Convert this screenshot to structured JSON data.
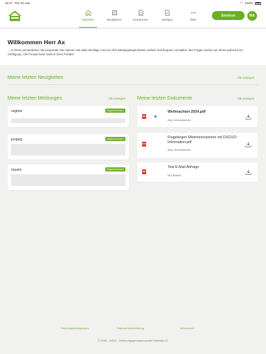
{
  "status_bar": {
    "time": "16:27",
    "date": "Thu 30 Jan",
    "battery": "100%"
  },
  "nav": {
    "items": [
      {
        "label": "Startseite",
        "icon": "home-icon"
      },
      {
        "label": "Neuigkeiten",
        "icon": "news-icon"
      },
      {
        "label": "Dokumente",
        "icon": "document-icon"
      },
      {
        "label": "Verträge",
        "icon": "contract-icon"
      },
      {
        "label": "Mehr",
        "icon": "more-icon"
      }
    ],
    "active": "Startseite"
  },
  "header": {
    "services_label": "Services",
    "avatar_initials": "MA"
  },
  "welcome": {
    "title": "Willkommen Herr Ax",
    "text": "... in Ihrem persönlichen Serviceportal! Hier können Sie alles Wichtige rund um Ihre Mietangelegenheiten einfach und bequem verwalten. Bei Fragen stehen wir Ihnen jederzeit zur Verfügung. Viel Freude beim Nutzen Ihres Portals!"
  },
  "news": {
    "title": "Meine letzten Neuigkeiten",
    "link": "Alle anzeigen"
  },
  "meldungen": {
    "title": "Meine letzten Meldungen",
    "link": "Alle anzeigen",
    "items": [
      {
        "title": "sxgtow",
        "status": "Abgeschlossen"
      },
      {
        "title": "juvgwg",
        "status": "Abgeschlossen"
      },
      {
        "title": "mpeits",
        "status": "Abgeschlossen"
      }
    ]
  },
  "dokumente": {
    "title": "Meine letzten Dokumente",
    "link": "Alle anzeigen",
    "items": [
      {
        "title": "Weihnachten 2024.pdf",
        "category": "Allg. Informationen",
        "unread": true
      },
      {
        "title": "Fragebogen Mietinteressenten mit DSGVO-Information.pdf",
        "category": "Allg. Informationen",
        "unread": false
      },
      {
        "title": "Test E-Mail Abfrage",
        "category": "MG-Beleht",
        "unread": false
      }
    ]
  },
  "footer": {
    "links": [
      "Nutzungsbedingungen",
      "Datenschutzerklärung",
      "Impressum"
    ],
    "copyright": "© 2025 - WGH – Wohnungsgenossenschaft Hüttental eG"
  },
  "colors": {
    "accent": "#6ab023",
    "pdf": "#e03a2e",
    "unread_dot": "#2a6fc1",
    "background": "#f1f1ef"
  }
}
